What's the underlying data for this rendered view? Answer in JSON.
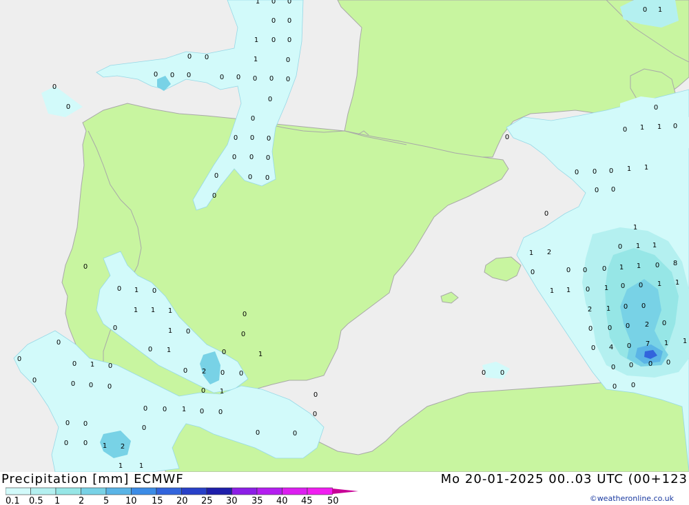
{
  "title": "Precipitation [mm] ECMWF",
  "timestamp": "Mo 20-01-2025 00..03 UTC (00+123",
  "credit": "©weatheronline.co.uk",
  "colors": {
    "sea": "#eeeeee",
    "land": "#c8f5a0",
    "border": "#a8a8a8"
  },
  "legend": {
    "labels": [
      "0.1",
      "0.5",
      "1",
      "2",
      "5",
      "10",
      "15",
      "20",
      "25",
      "30",
      "35",
      "40",
      "45",
      "50"
    ],
    "colors": [
      "#d2fafa",
      "#b4f0f0",
      "#96e6e6",
      "#78d2e6",
      "#5ab4e6",
      "#3c8ce6",
      "#3264dc",
      "#2840c8",
      "#1e1eaa",
      "#8c1ee6",
      "#b41ef0",
      "#dc1ef0",
      "#f01ef0",
      "#c80096"
    ]
  },
  "values": [
    {
      "t": "1"
    },
    {
      "t": "0"
    },
    {
      "t": "0"
    },
    {
      "t": "0"
    },
    {
      "t": "0"
    },
    {
      "t": "1"
    },
    {
      "t": "0"
    },
    {
      "t": "0"
    },
    {
      "t": "0"
    },
    {
      "t": "0"
    },
    {
      "t": "1"
    },
    {
      "t": "0"
    },
    {
      "t": "0"
    },
    {
      "t": "0"
    },
    {
      "t": "0"
    },
    {
      "t": "0"
    },
    {
      "t": "0"
    },
    {
      "t": "0"
    },
    {
      "t": "0"
    },
    {
      "t": "0"
    },
    {
      "t": "0"
    },
    {
      "t": "0"
    },
    {
      "t": "0"
    },
    {
      "t": "0"
    },
    {
      "t": "0"
    },
    {
      "t": "0"
    },
    {
      "t": "0"
    },
    {
      "t": "0"
    },
    {
      "t": "0"
    },
    {
      "t": "0"
    },
    {
      "t": "0"
    },
    {
      "t": "0"
    },
    {
      "t": "0"
    },
    {
      "t": "0"
    },
    {
      "t": "0"
    },
    {
      "t": "1"
    },
    {
      "t": "0"
    },
    {
      "t": "1"
    },
    {
      "t": "1"
    },
    {
      "t": "1"
    },
    {
      "t": "0"
    },
    {
      "t": "0"
    },
    {
      "t": "1"
    },
    {
      "t": "0"
    },
    {
      "t": "0"
    },
    {
      "t": "0"
    },
    {
      "t": "1"
    },
    {
      "t": "0"
    },
    {
      "t": "1"
    },
    {
      "t": "0"
    },
    {
      "t": "0"
    },
    {
      "t": "0"
    },
    {
      "t": "1"
    },
    {
      "t": "0"
    },
    {
      "t": "0"
    },
    {
      "t": "2"
    },
    {
      "t": "0"
    },
    {
      "t": "0"
    },
    {
      "t": "0"
    },
    {
      "t": "0"
    },
    {
      "t": "0"
    },
    {
      "t": "0"
    },
    {
      "t": "0"
    },
    {
      "t": "0"
    },
    {
      "t": "1"
    },
    {
      "t": "0"
    },
    {
      "t": "0"
    },
    {
      "t": "0"
    },
    {
      "t": "0"
    },
    {
      "t": "0"
    },
    {
      "t": "0"
    },
    {
      "t": "0"
    },
    {
      "t": "0"
    },
    {
      "t": "0"
    },
    {
      "t": "1"
    },
    {
      "t": "2"
    },
    {
      "t": "0"
    },
    {
      "t": "0"
    },
    {
      "t": "1"
    },
    {
      "t": "1"
    },
    {
      "t": "0"
    },
    {
      "t": "1"
    },
    {
      "t": "0"
    },
    {
      "t": "0"
    },
    {
      "t": "0"
    },
    {
      "t": "0"
    },
    {
      "t": "0"
    },
    {
      "t": "1"
    },
    {
      "t": "1"
    },
    {
      "t": "0"
    },
    {
      "t": "0"
    },
    {
      "t": "1"
    },
    {
      "t": "0"
    },
    {
      "t": "1"
    },
    {
      "t": "1"
    },
    {
      "t": "0"
    },
    {
      "t": "1"
    },
    {
      "t": "0"
    },
    {
      "t": "0"
    },
    {
      "t": "0"
    },
    {
      "t": "0"
    },
    {
      "t": "1"
    },
    {
      "t": "1"
    },
    {
      "t": "0"
    },
    {
      "t": "0"
    },
    {
      "t": "1"
    },
    {
      "t": "1"
    },
    {
      "t": "2"
    },
    {
      "t": "0"
    },
    {
      "t": "0"
    },
    {
      "t": "0"
    },
    {
      "t": "0"
    },
    {
      "t": "0"
    },
    {
      "t": "0"
    },
    {
      "t": "1"
    },
    {
      "t": "8"
    },
    {
      "t": "1"
    },
    {
      "t": "0"
    },
    {
      "t": "1"
    },
    {
      "t": "1"
    },
    {
      "t": "2"
    },
    {
      "t": "1"
    },
    {
      "t": "0"
    },
    {
      "t": "0"
    },
    {
      "t": "1"
    },
    {
      "t": "0"
    },
    {
      "t": "1"
    },
    {
      "t": "0"
    },
    {
      "t": "0"
    },
    {
      "t": "0"
    },
    {
      "t": "2"
    },
    {
      "t": "0"
    },
    {
      "t": "0"
    },
    {
      "t": "4"
    },
    {
      "t": "0"
    },
    {
      "t": "7"
    },
    {
      "t": "1"
    },
    {
      "t": "1"
    },
    {
      "t": "0"
    },
    {
      "t": "0"
    },
    {
      "t": "0"
    },
    {
      "t": "0"
    },
    {
      "t": "0"
    },
    {
      "t": "0"
    }
  ]
}
